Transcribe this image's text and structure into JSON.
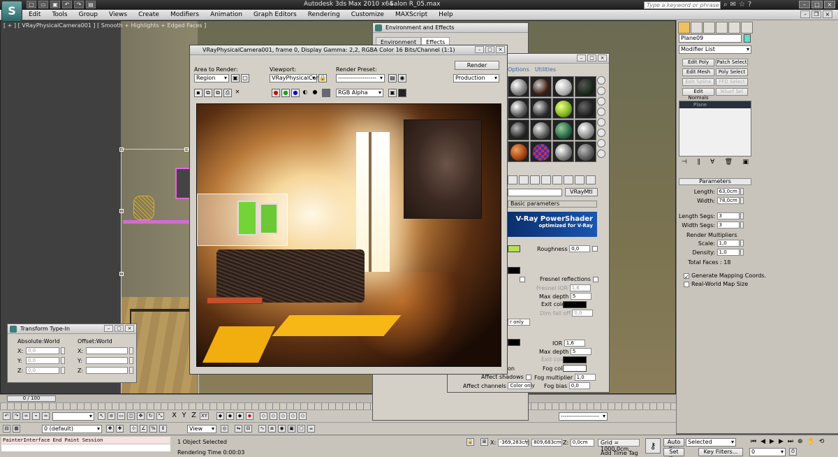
{
  "app": {
    "logo": "S",
    "title": "Autodesk 3ds Max  2010 x64",
    "file": "Salon R_05.max",
    "search_placeholder": "Type a keyword or phrase"
  },
  "menu": [
    "Edit",
    "Tools",
    "Group",
    "Views",
    "Create",
    "Modifiers",
    "Animation",
    "Graph Editors",
    "Rendering",
    "Customize",
    "MAXScript",
    "Help"
  ],
  "viewport": {
    "label": "[ + ] [ VRayPhysicalCamera001 ] [ Smooth + Highlights + Edged Faces ]"
  },
  "transform": {
    "title": "Transform Type-In",
    "absolute_label": "Absolute:World",
    "offset_label": "Offset:World",
    "x_label": "X:",
    "y_label": "Y:",
    "z_label": "Z:",
    "abs_x": "0,0",
    "abs_y": "0,0",
    "abs_z": "0,0"
  },
  "envfx": {
    "title": "Environment and Effects",
    "tab_environment": "Environment",
    "tab_effects": "Effects"
  },
  "render_frame": {
    "title": "VRayPhysicalCamera001, frame 0, Display Gamma: 2,2, RGBA Color 16 Bits/Channel (1:1)",
    "area_label": "Area to Render:",
    "area_value": "Region",
    "viewport_label": "Viewport:",
    "viewport_value": "VRayPhysicalCam",
    "preset_label": "Render Preset:",
    "preset_value": "-------------------",
    "render_button": "Render",
    "production_value": "Production",
    "channel_value": "RGB Alpha"
  },
  "material_editor": {
    "menu_options": "Options",
    "menu_utilities": "Utilities",
    "type_button": "VRayMtl",
    "rollout_basic": "Basic parameters",
    "banner_title": "V-Ray PowerShader",
    "banner_sub": "optimized for V-Ray",
    "roughness_label": "Roughness",
    "roughness_value": "0,0",
    "fresnel_label": "Fresnel reflections",
    "fresnel_ior_label": "Fresnel IOR",
    "fresnel_ior_value": "1,6",
    "max_depth_label": "Max depth",
    "max_depth_value": "5",
    "exit_color_label": "Exit color",
    "dim_falloff_label": "Dim fall off",
    "dim_falloff_value": "0,0",
    "only_label": "r only",
    "ior_label": "IOR",
    "ior_value": "1,6",
    "max_depth2_label": "Max depth",
    "max_depth2_value": "5",
    "exit_color2_label": "Exit color",
    "fog_color_label": "Fog color",
    "fog_mult_label": "Fog multiplier",
    "fog_mult_value": "1,0",
    "fog_bias_label": "Fog bias",
    "fog_bias_value": "0,0",
    "affect_shadows_label": "Affect shadows",
    "affect_channels_label": "Affect channels",
    "affect_channels_value": "Color only",
    "on_label": "on"
  },
  "command_panel": {
    "object_name": "Plane09",
    "modifier_list": "Modifier List",
    "buttons": [
      "Edit Poly",
      "Patch Select",
      "Edit Mesh",
      "Poly Select",
      "Edit Spline",
      "FFD Select",
      "Edit Normals",
      "NSurf Sel"
    ],
    "stack_item": "Plane",
    "params_title": "Parameters",
    "length_label": "Length:",
    "length_value": "63,0cm",
    "width_label": "Width:",
    "width_value": "78,0cm",
    "length_segs_label": "Length Segs:",
    "length_segs_value": "3",
    "width_segs_label": "Width Segs:",
    "width_segs_value": "3",
    "render_mult_label": "Render Multipliers",
    "scale_label": "Scale:",
    "scale_value": "1,0",
    "density_label": "Density:",
    "density_value": "1,0",
    "total_faces": "Total Faces : 18",
    "gen_mapping_label": "Generate Mapping Coords.",
    "real_world_label": "Real-World Map Size"
  },
  "timeline": {
    "frame_range": "0 / 100"
  },
  "toolbar": {
    "layer_value": "0 (default)",
    "view_value": "View",
    "selection_set": "-------------------",
    "axis_x": "X",
    "axis_y": "Y",
    "axis_z": "Z",
    "axis_xy": "XY"
  },
  "status": {
    "maxscript_line": "PainterInterface End Paint Session",
    "selected": "1 Object Selected",
    "render_time": "Rendering Time  0:00:03",
    "x_label": "X:",
    "y_label": "Y:",
    "z_label": "Z:",
    "x_value": "-369,283cr",
    "y_value": "809,683cm",
    "z_value": "0,0cm",
    "grid": "Grid = 1000,0cm",
    "add_time_tag": "Add Time Tag",
    "auto_key": "Auto Key",
    "set_key": "Set Key",
    "selected_dd": "Selected",
    "key_filters": "Key Filters...",
    "frame_value": "0"
  },
  "colors": {
    "object_color": "#5ee0d0",
    "vray_banner": "#1a56b0",
    "diffuse_swatch": "#b7e04a"
  }
}
